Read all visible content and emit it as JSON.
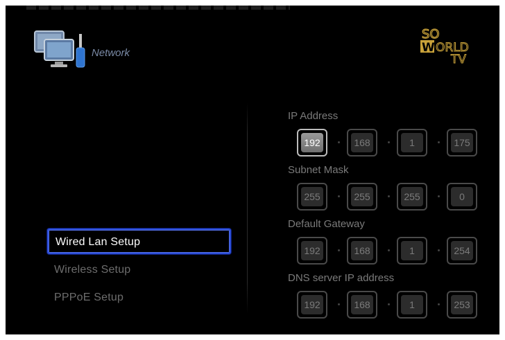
{
  "header": {
    "title": "Network",
    "icon": "network-computer-icon",
    "logo": {
      "line1": "SO",
      "line2": "WORLD",
      "line3": "TV"
    }
  },
  "menu": {
    "items": [
      {
        "label": "Wired Lan Setup",
        "selected": true
      },
      {
        "label": "Wireless Setup",
        "selected": false
      },
      {
        "label": "PPPoE Setup",
        "selected": false
      }
    ]
  },
  "fields": {
    "ip_address": {
      "label": "IP Address",
      "octets": [
        "192",
        "168",
        "1",
        "175"
      ]
    },
    "subnet_mask": {
      "label": "Subnet Mask",
      "octets": [
        "255",
        "255",
        "255",
        "0"
      ]
    },
    "default_gateway": {
      "label": "Default Gateway",
      "octets": [
        "192",
        "168",
        "1",
        "254"
      ]
    },
    "dns_server": {
      "label": "DNS server IP address",
      "octets": [
        "192",
        "168",
        "1",
        "253"
      ]
    }
  },
  "colors": {
    "selection_border": "#2d4ed8",
    "logo_gold": "#c9a23a"
  }
}
